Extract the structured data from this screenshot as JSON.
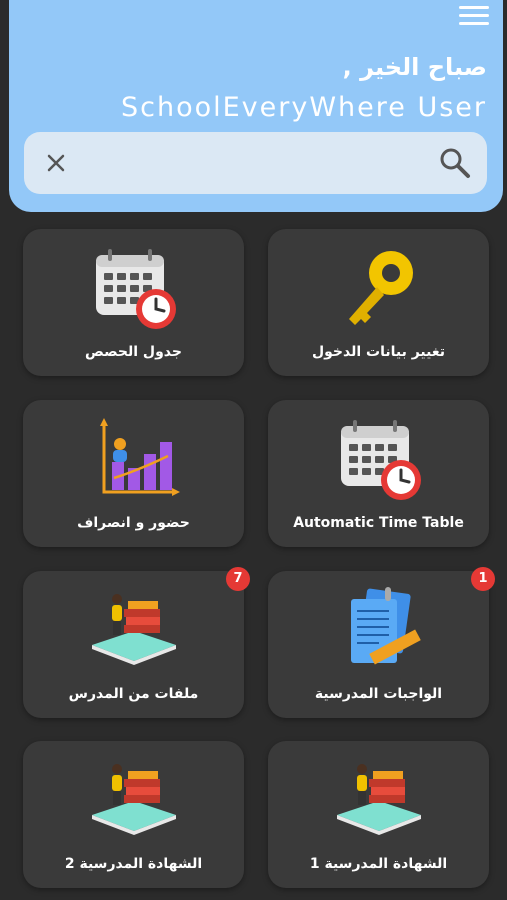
{
  "header": {
    "greeting": "صباح الخير ,",
    "username": "SchoolEveryWhere User",
    "menu_icon": "hamburger-menu-icon"
  },
  "search": {
    "placeholder": "",
    "value": ""
  },
  "cards": [
    {
      "label": "تغيير بيانات الدخول",
      "icon": "key-icon"
    },
    {
      "label": "جدول الحصص",
      "icon": "calendar-clock-icon"
    },
    {
      "label": "Automatic Time Table",
      "icon": "calendar-clock-icon"
    },
    {
      "label": "حضور و انصراف",
      "icon": "bar-chart-person-icon"
    },
    {
      "label": "الواجبات المدرسية",
      "icon": "documents-ruler-icon",
      "badge": "1"
    },
    {
      "label": "ملفات من المدرس",
      "icon": "books-teacher-icon",
      "badge": "7"
    },
    {
      "label": "الشهادة المدرسية 1",
      "icon": "books-teacher-icon"
    },
    {
      "label": "الشهادة المدرسية 2",
      "icon": "books-teacher-icon"
    }
  ],
  "colors": {
    "header_bg": "#93c8f8",
    "background": "#2b2b2b",
    "card_bg": "#3a3a3a",
    "badge": "#e53935"
  }
}
